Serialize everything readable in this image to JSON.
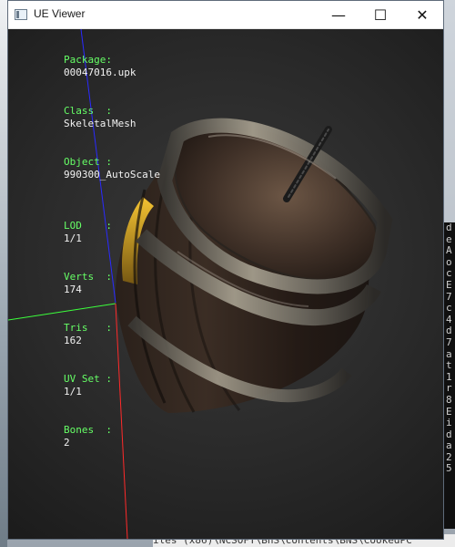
{
  "window": {
    "title": "UE Viewer",
    "controls": {
      "minimize": "—",
      "maximize": "☐",
      "close": "✕"
    }
  },
  "hud": {
    "package_label": "Package:",
    "package_value": "00047016.upk",
    "class_label": "Class  :",
    "class_value": "SkeletalMesh",
    "object_label": "Object :",
    "object_value": "990300_AutoScale",
    "lod_label": "LOD    :",
    "lod_value": "1/1",
    "verts_label": "Verts  :",
    "verts_value": "174",
    "tris_label": "Tris   :",
    "tris_value": "162",
    "uvset_label": "UV Set :",
    "uvset_value": "1/1",
    "bones_label": "Bones  :",
    "bones_value": "2"
  },
  "background": {
    "bottom_strip": "iles (x86)\\NCSOFT\\BnS\\contents\\BNS\\CookedPC",
    "console_lines": [
      "d",
      "e",
      "A",
      "o",
      "c",
      "E",
      "7",
      "c",
      "4",
      "d",
      "7",
      "a",
      "t",
      "1",
      "r",
      "8",
      "E",
      "i",
      "d",
      "a",
      "2",
      "5"
    ]
  },
  "colors": {
    "hud_label": "#66ff66",
    "hud_value": "#f2f2f2",
    "axis_x": "#ff2a2a",
    "axis_y": "#3cff3c",
    "axis_z": "#2a2aff"
  }
}
